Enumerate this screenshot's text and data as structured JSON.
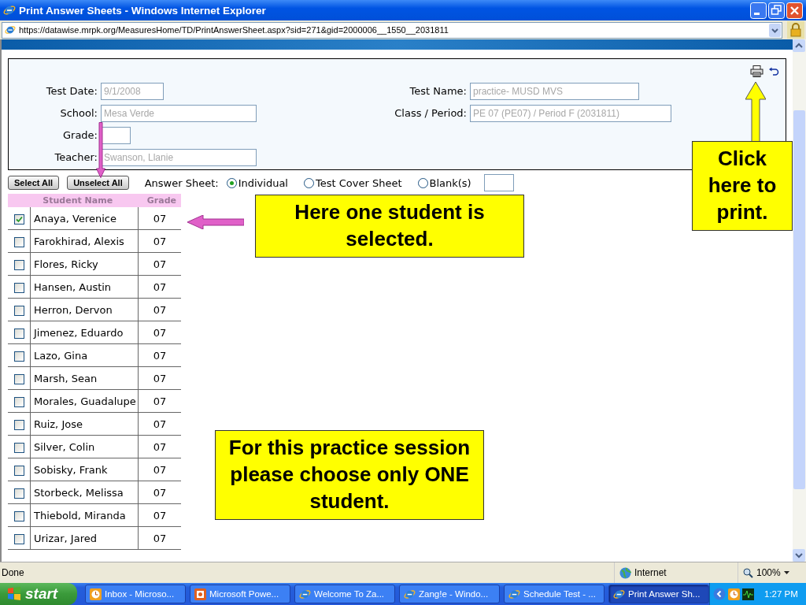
{
  "window": {
    "title": "Print Answer Sheets - Windows Internet Explorer"
  },
  "address_bar": {
    "url": "https://datawise.mrpk.org/MeasuresHome/TD/PrintAnswerSheet.aspx?sid=271&gid=2000006__1550__2031811"
  },
  "form": {
    "left": [
      {
        "label": "Test Date:",
        "value": "9/1/2008"
      },
      {
        "label": "School:",
        "value": "Mesa Verde"
      },
      {
        "label": "Grade:"
      },
      {
        "label": "Teacher:",
        "value": "Swanson, Llanie"
      }
    ],
    "right": [
      {
        "label": "Test Name:",
        "value": "practice- MUSD MVS"
      },
      {
        "label": "Class / Period:",
        "value": "PE 07 (PE07) / Period F (2031811)"
      }
    ]
  },
  "buttons": [
    "Select All",
    "Unselect All"
  ],
  "answer_sheet": {
    "label": "Answer Sheet:",
    "options": [
      {
        "label": "Individual",
        "selected": true
      },
      {
        "label": "Test Cover Sheet",
        "selected": false
      },
      {
        "label": "Blank(s)",
        "selected": false
      }
    ]
  },
  "table": {
    "columns": [
      "Student Name",
      "Grade"
    ],
    "rows": [
      {
        "name": "Anaya, Verenice",
        "grade": "07",
        "checked": true
      },
      {
        "name": "Farokhirad, Alexis",
        "grade": "07",
        "checked": false
      },
      {
        "name": "Flores, Ricky",
        "grade": "07",
        "checked": false
      },
      {
        "name": "Hansen, Austin",
        "grade": "07",
        "checked": false
      },
      {
        "name": "Herron, Dervon",
        "grade": "07",
        "checked": false
      },
      {
        "name": "Jimenez, Eduardo",
        "grade": "07",
        "checked": false
      },
      {
        "name": "Lazo, Gina",
        "grade": "07",
        "checked": false
      },
      {
        "name": "Marsh, Sean",
        "grade": "07",
        "checked": false
      },
      {
        "name": "Morales, Guadalupe",
        "grade": "07",
        "checked": false
      },
      {
        "name": "Ruiz, Jose",
        "grade": "07",
        "checked": false
      },
      {
        "name": "Silver, Colin",
        "grade": "07",
        "checked": false
      },
      {
        "name": "Sobisky, Frank",
        "grade": "07",
        "checked": false
      },
      {
        "name": "Storbeck, Melissa",
        "grade": "07",
        "checked": false
      },
      {
        "name": "Thiebold, Miranda",
        "grade": "07",
        "checked": false
      },
      {
        "name": "Urizar, Jared",
        "grade": "07",
        "checked": false
      }
    ]
  },
  "callouts": [
    {
      "text": "Here one student is selected."
    },
    {
      "text": "Click here to print."
    },
    {
      "text": "For this practice session please choose only **ONE** student."
    }
  ],
  "status_bar": {
    "text": "Done",
    "zone": "Internet",
    "zoom": "100%"
  },
  "taskbar": {
    "start": "start",
    "tasks": [
      {
        "label": "Inbox - Microso...",
        "kind": "mail",
        "selected": false
      },
      {
        "label": "Microsoft Powe...",
        "kind": "slides",
        "selected": false
      },
      {
        "label": "Welcome To Za...",
        "kind": "browser",
        "selected": false
      },
      {
        "label": "Zang!e - Windo...",
        "kind": "browser",
        "selected": false
      },
      {
        "label": "Schedule Test - ...",
        "kind": "browser",
        "selected": false
      },
      {
        "label": "Print Answer Sh...",
        "kind": "browser",
        "selected": true
      }
    ],
    "clock": "1:27 PM"
  }
}
